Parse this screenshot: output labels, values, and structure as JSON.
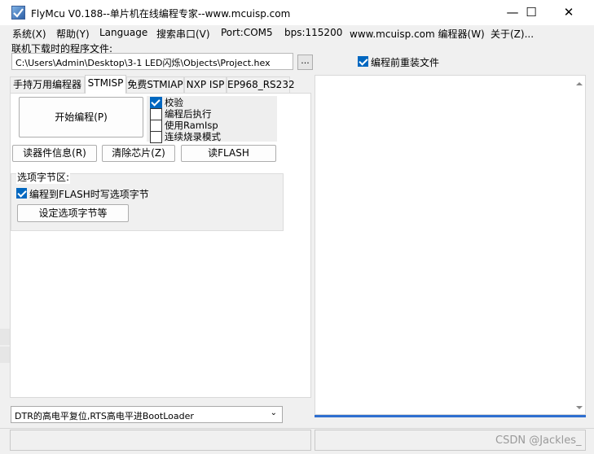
{
  "window": {
    "title": "FlyMcu V0.188--单片机在线编程专家--www.mcuisp.com",
    "minimize": "—",
    "maximize": "☐",
    "close": "✕"
  },
  "menu": {
    "items": [
      "系统(X)",
      "帮助(Y)",
      "Language",
      "搜索串口(V)",
      "Port:COM5",
      "bps:115200",
      "www.mcuisp.com 编程器(W)",
      "关于(Z)..."
    ]
  },
  "file": {
    "label": "联机下载时的程序文件:",
    "path": "C:\\Users\\Admin\\Desktop\\3-1 LED闪烁\\Objects\\Project.hex",
    "browse_label": "...",
    "reload_label": "编程前重装文件",
    "reload_checked": true
  },
  "tabs": [
    {
      "label": "手持万用编程器",
      "active": false
    },
    {
      "label": "STMISP",
      "active": true
    },
    {
      "label": "免费STMIAP",
      "active": false
    },
    {
      "label": "NXP ISP",
      "active": false
    },
    {
      "label": "EP968_RS232",
      "active": false
    }
  ],
  "stmisp": {
    "program_button": "开始编程(P)",
    "options": [
      {
        "label": "校验",
        "checked": true
      },
      {
        "label": "编程后执行",
        "checked": false
      },
      {
        "label": "使用RamIsp",
        "checked": false
      },
      {
        "label": "连续烧录模式",
        "checked": false
      }
    ],
    "read_info_button": "读器件信息(R)",
    "erase_button": "清除芯片(Z)",
    "read_flash_button": "读FLASH",
    "option_bytes": {
      "title": "选项字节区:",
      "write_option_label": "编程到FLASH时写选项字节",
      "write_option_checked": true,
      "set_button": "设定选项字节等"
    }
  },
  "bootmode": {
    "selected": "DTR的高电平复位,RTS高电平进BootLoader"
  },
  "watermark": "CSDN @Jackles_",
  "colors": {
    "accent": "#0067c0",
    "progress": "#2f6fd0"
  }
}
